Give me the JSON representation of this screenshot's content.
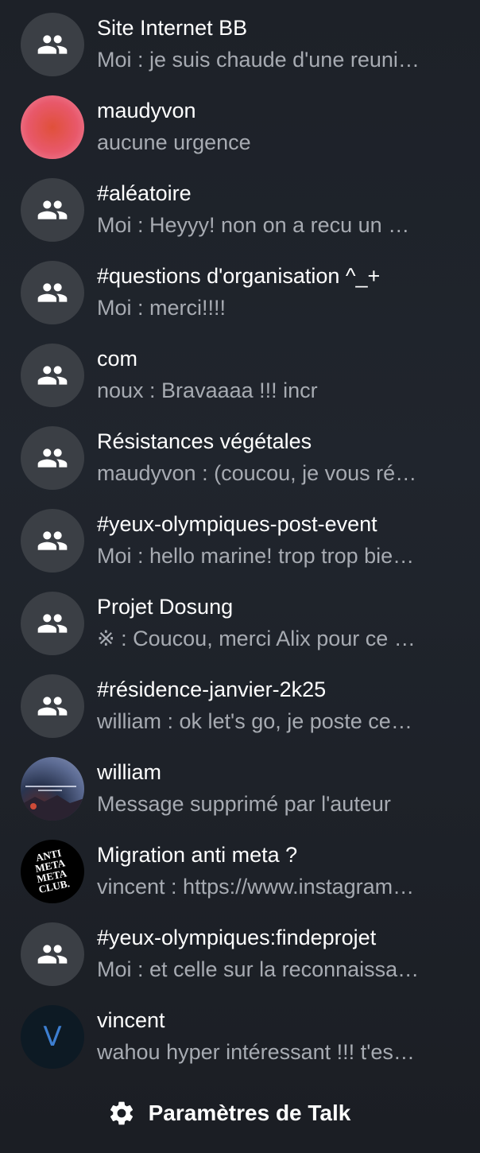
{
  "conversations": [
    {
      "name": "Site Internet BB",
      "preview": "Moi : je suis chaude d'une reuni…",
      "avatar": "group-icon"
    },
    {
      "name": "maudyvon",
      "preview": "aucune urgence",
      "avatar": "user-avatar"
    },
    {
      "name": "#aléatoire",
      "preview": "Moi : Heyyy! non on a recu un …",
      "avatar": "group-icon"
    },
    {
      "name": "#questions d'organisation ^_+",
      "preview": "Moi : merci!!!!",
      "avatar": "group-icon"
    },
    {
      "name": "com",
      "preview": "noux : Bravaaaa !!! incr",
      "avatar": "group-icon"
    },
    {
      "name": "Résistances végétales",
      "preview": "maudyvon : (coucou, je vous ré…",
      "avatar": "group-icon"
    },
    {
      "name": "#yeux-olympiques-post-event",
      "preview": "Moi : hello marine! trop trop bie…",
      "avatar": "group-icon"
    },
    {
      "name": "Projet Dosung",
      "preview": "※ : Coucou, merci Alix pour ce …",
      "avatar": "group-icon"
    },
    {
      "name": "#résidence-janvier-2k25",
      "preview": "william : ok let's go, je poste ce…",
      "avatar": "group-icon"
    },
    {
      "name": "william",
      "preview": "Message supprimé par l'auteur",
      "avatar": "user-photo"
    },
    {
      "name": "Migration anti meta ?",
      "preview": "vincent : https://www.instagram…",
      "avatar": "anti-meta-logo",
      "logo_text": [
        "ANTI",
        "META",
        "META",
        "CLUB."
      ]
    },
    {
      "name": "#yeux-olympiques:findeprojet",
      "preview": "Moi : et celle sur la reconnaissa…",
      "avatar": "group-icon"
    },
    {
      "name": "vincent",
      "preview": "wahou hyper intéressant !!! t'es…",
      "avatar": "letter-avatar",
      "initial": "V"
    }
  ],
  "settings": {
    "label": "Paramètres de Talk",
    "icon": "gear-icon"
  },
  "colors": {
    "background": "#1b1e24",
    "group_avatar": "#3b3f45",
    "preview_text": "#a7abb2",
    "initial_letter": "#3d7fd1"
  }
}
